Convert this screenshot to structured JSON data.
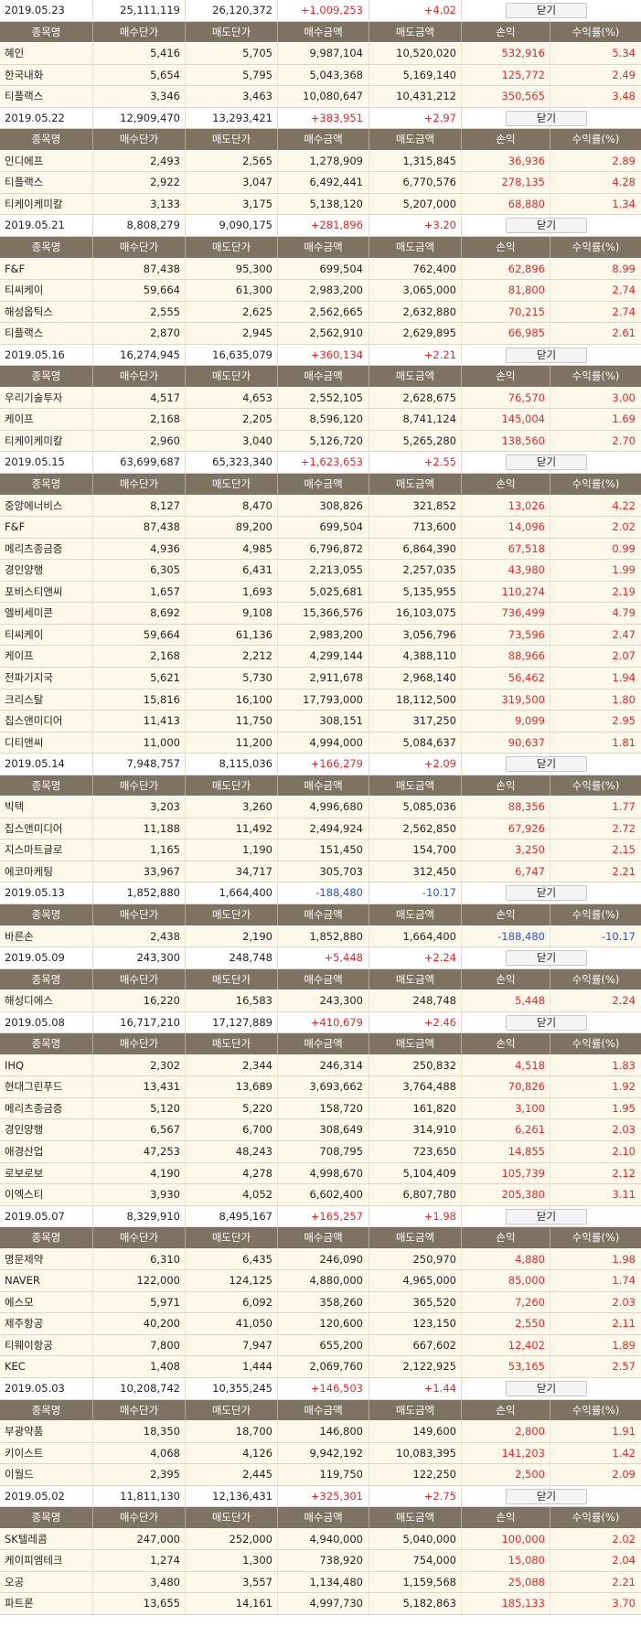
{
  "columns": [
    "종목명",
    "매수단가",
    "매도단가",
    "매수금액",
    "매도금액",
    "손익",
    "수익률(%)"
  ],
  "close_label": "닫기",
  "colors": {
    "header_bg": "#7e7261",
    "row_bg": "#fdf9ea",
    "positive": "#e32a2a",
    "negative": "#2450d8"
  },
  "days": [
    {
      "date": "2019.05.23",
      "buy_total": "25,111,119",
      "sell_total": "26,120,372",
      "pnl": "+1,009,253",
      "rate": "+4.02",
      "sign": "pos",
      "rows": [
        [
          "혜인",
          "5,416",
          "5,705",
          "9,987,104",
          "10,520,020",
          "532,916",
          "5.34"
        ],
        [
          "한국내화",
          "5,654",
          "5,795",
          "5,043,368",
          "5,169,140",
          "125,772",
          "2.49"
        ],
        [
          "티플랙스",
          "3,346",
          "3,463",
          "10,080,647",
          "10,431,212",
          "350,565",
          "3.48"
        ]
      ]
    },
    {
      "date": "2019.05.22",
      "buy_total": "12,909,470",
      "sell_total": "13,293,421",
      "pnl": "+383,951",
      "rate": "+2.97",
      "sign": "pos",
      "rows": [
        [
          "인디에프",
          "2,493",
          "2,565",
          "1,278,909",
          "1,315,845",
          "36,936",
          "2.89"
        ],
        [
          "티플랙스",
          "2,922",
          "3,047",
          "6,492,441",
          "6,770,576",
          "278,135",
          "4.28"
        ],
        [
          "티케이케미칼",
          "3,133",
          "3,175",
          "5,138,120",
          "5,207,000",
          "68,880",
          "1.34"
        ]
      ]
    },
    {
      "date": "2019.05.21",
      "buy_total": "8,808,279",
      "sell_total": "9,090,175",
      "pnl": "+281,896",
      "rate": "+3.20",
      "sign": "pos",
      "rows": [
        [
          "F&F",
          "87,438",
          "95,300",
          "699,504",
          "762,400",
          "62,896",
          "8.99"
        ],
        [
          "티씨케이",
          "59,664",
          "61,300",
          "2,983,200",
          "3,065,000",
          "81,800",
          "2.74"
        ],
        [
          "해성옵틱스",
          "2,555",
          "2,625",
          "2,562,665",
          "2,632,880",
          "70,215",
          "2.74"
        ],
        [
          "티플랙스",
          "2,870",
          "2,945",
          "2,562,910",
          "2,629,895",
          "66,985",
          "2.61"
        ]
      ]
    },
    {
      "date": "2019.05.16",
      "buy_total": "16,274,945",
      "sell_total": "16,635,079",
      "pnl": "+360,134",
      "rate": "+2.21",
      "sign": "pos",
      "rows": [
        [
          "우리기술투자",
          "4,517",
          "4,653",
          "2,552,105",
          "2,628,675",
          "76,570",
          "3.00"
        ],
        [
          "케이프",
          "2,168",
          "2,205",
          "8,596,120",
          "8,741,124",
          "145,004",
          "1.69"
        ],
        [
          "티케이케미칼",
          "2,960",
          "3,040",
          "5,126,720",
          "5,265,280",
          "138,560",
          "2.70"
        ]
      ]
    },
    {
      "date": "2019.05.15",
      "buy_total": "63,699,687",
      "sell_total": "65,323,340",
      "pnl": "+1,623,653",
      "rate": "+2.55",
      "sign": "pos",
      "rows": [
        [
          "중앙에너비스",
          "8,127",
          "8,470",
          "308,826",
          "321,852",
          "13,026",
          "4.22"
        ],
        [
          "F&F",
          "87,438",
          "89,200",
          "699,504",
          "713,600",
          "14,096",
          "2.02"
        ],
        [
          "메리츠종금증",
          "4,936",
          "4,985",
          "6,796,872",
          "6,864,390",
          "67,518",
          "0.99"
        ],
        [
          "경인양행",
          "6,305",
          "6,431",
          "2,213,055",
          "2,257,035",
          "43,980",
          "1.99"
        ],
        [
          "포비스티앤씨",
          "1,657",
          "1,693",
          "5,025,681",
          "5,135,955",
          "110,274",
          "2.19"
        ],
        [
          "엘비세미콘",
          "8,692",
          "9,108",
          "15,366,576",
          "16,103,075",
          "736,499",
          "4.79"
        ],
        [
          "티씨케이",
          "59,664",
          "61,136",
          "2,983,200",
          "3,056,796",
          "73,596",
          "2.47"
        ],
        [
          "케이프",
          "2,168",
          "2,212",
          "4,299,144",
          "4,388,110",
          "88,966",
          "2.07"
        ],
        [
          "전파기지국",
          "5,621",
          "5,730",
          "2,911,678",
          "2,968,140",
          "56,462",
          "1.94"
        ],
        [
          "크리스탈",
          "15,816",
          "16,100",
          "17,793,000",
          "18,112,500",
          "319,500",
          "1.80"
        ],
        [
          "칩스앤미디어",
          "11,413",
          "11,750",
          "308,151",
          "317,250",
          "9,099",
          "2.95"
        ],
        [
          "디티앤씨",
          "11,000",
          "11,200",
          "4,994,000",
          "5,084,637",
          "90,637",
          "1.81"
        ]
      ]
    },
    {
      "date": "2019.05.14",
      "buy_total": "7,948,757",
      "sell_total": "8,115,036",
      "pnl": "+166,279",
      "rate": "+2.09",
      "sign": "pos",
      "rows": [
        [
          "빅텍",
          "3,203",
          "3,260",
          "4,996,680",
          "5,085,036",
          "88,356",
          "1.77"
        ],
        [
          "칩스앤미디어",
          "11,188",
          "11,492",
          "2,494,924",
          "2,562,850",
          "67,926",
          "2.72"
        ],
        [
          "지스마트글로",
          "1,165",
          "1,190",
          "151,450",
          "154,700",
          "3,250",
          "2.15"
        ],
        [
          "에코마케팅",
          "33,967",
          "34,717",
          "305,703",
          "312,450",
          "6,747",
          "2.21"
        ]
      ]
    },
    {
      "date": "2019.05.13",
      "buy_total": "1,852,880",
      "sell_total": "1,664,400",
      "pnl": "-188,480",
      "rate": "-10.17",
      "sign": "neg",
      "rows": [
        [
          "바른손",
          "2,438",
          "2,190",
          "1,852,880",
          "1,664,400",
          "-188,480",
          "-10.17"
        ]
      ]
    },
    {
      "date": "2019.05.09",
      "buy_total": "243,300",
      "sell_total": "248,748",
      "pnl": "+5,448",
      "rate": "+2.24",
      "sign": "pos",
      "rows": [
        [
          "해성디에스",
          "16,220",
          "16,583",
          "243,300",
          "248,748",
          "5,448",
          "2.24"
        ]
      ]
    },
    {
      "date": "2019.05.08",
      "buy_total": "16,717,210",
      "sell_total": "17,127,889",
      "pnl": "+410,679",
      "rate": "+2.46",
      "sign": "pos",
      "rows": [
        [
          "IHQ",
          "2,302",
          "2,344",
          "246,314",
          "250,832",
          "4,518",
          "1.83"
        ],
        [
          "현대그린푸드",
          "13,431",
          "13,689",
          "3,693,662",
          "3,764,488",
          "70,826",
          "1.92"
        ],
        [
          "메리츠종금증",
          "5,120",
          "5,220",
          "158,720",
          "161,820",
          "3,100",
          "1.95"
        ],
        [
          "경인양행",
          "6,567",
          "6,700",
          "308,649",
          "314,910",
          "6,261",
          "2.03"
        ],
        [
          "애경산업",
          "47,253",
          "48,243",
          "708,795",
          "723,650",
          "14,855",
          "2.10"
        ],
        [
          "로보로보",
          "4,190",
          "4,278",
          "4,998,670",
          "5,104,409",
          "105,739",
          "2.12"
        ],
        [
          "이엑스티",
          "3,930",
          "4,052",
          "6,602,400",
          "6,807,780",
          "205,380",
          "3.11"
        ]
      ]
    },
    {
      "date": "2019.05.07",
      "buy_total": "8,329,910",
      "sell_total": "8,495,167",
      "pnl": "+165,257",
      "rate": "+1.98",
      "sign": "pos",
      "rows": [
        [
          "명문제약",
          "6,310",
          "6,435",
          "246,090",
          "250,970",
          "4,880",
          "1.98"
        ],
        [
          "NAVER",
          "122,000",
          "124,125",
          "4,880,000",
          "4,965,000",
          "85,000",
          "1.74"
        ],
        [
          "에스모",
          "5,971",
          "6,092",
          "358,260",
          "365,520",
          "7,260",
          "2.03"
        ],
        [
          "제주항공",
          "40,200",
          "41,050",
          "120,600",
          "123,150",
          "2,550",
          "2.11"
        ],
        [
          "티웨이항공",
          "7,800",
          "7,947",
          "655,200",
          "667,602",
          "12,402",
          "1.89"
        ],
        [
          "KEC",
          "1,408",
          "1,444",
          "2,069,760",
          "2,122,925",
          "53,165",
          "2.57"
        ]
      ]
    },
    {
      "date": "2019.05.03",
      "buy_total": "10,208,742",
      "sell_total": "10,355,245",
      "pnl": "+146,503",
      "rate": "+1.44",
      "sign": "pos",
      "rows": [
        [
          "부광약품",
          "18,350",
          "18,700",
          "146,800",
          "149,600",
          "2,800",
          "1.91"
        ],
        [
          "키이스트",
          "4,068",
          "4,126",
          "9,942,192",
          "10,083,395",
          "141,203",
          "1.42"
        ],
        [
          "이월드",
          "2,395",
          "2,445",
          "119,750",
          "122,250",
          "2,500",
          "2.09"
        ]
      ]
    },
    {
      "date": "2019.05.02",
      "buy_total": "11,811,130",
      "sell_total": "12,136,431",
      "pnl": "+325,301",
      "rate": "+2.75",
      "sign": "pos",
      "rows": [
        [
          "SK텔레콤",
          "247,000",
          "252,000",
          "4,940,000",
          "5,040,000",
          "100,000",
          "2.02"
        ],
        [
          "케이피엠테크",
          "1,274",
          "1,300",
          "738,920",
          "754,000",
          "15,080",
          "2.04"
        ],
        [
          "오공",
          "3,480",
          "3,557",
          "1,134,480",
          "1,159,568",
          "25,088",
          "2.21"
        ],
        [
          "파트론",
          "13,655",
          "14,161",
          "4,997,730",
          "5,182,863",
          "185,133",
          "3.70"
        ]
      ]
    }
  ]
}
